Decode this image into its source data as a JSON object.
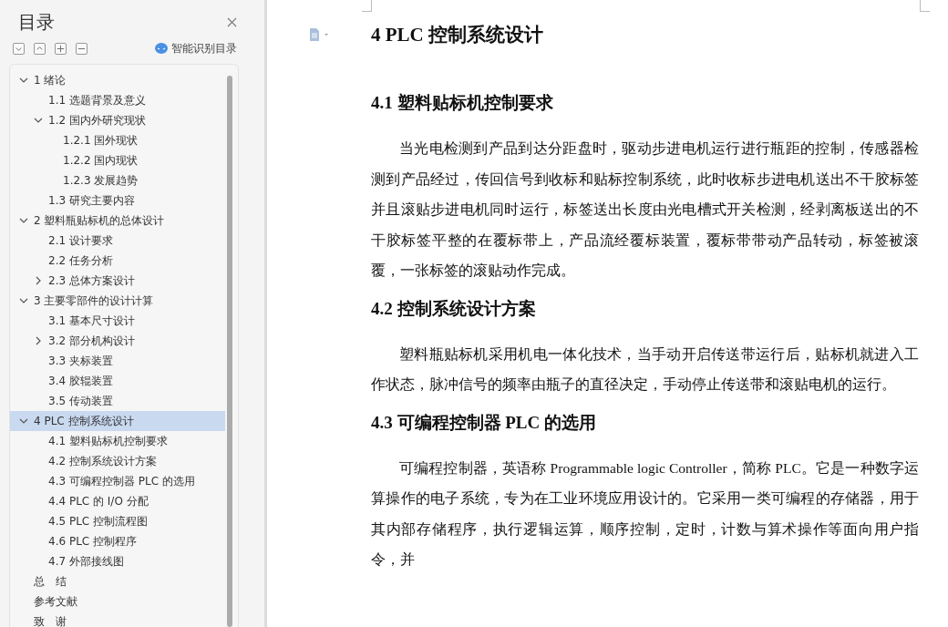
{
  "sidebar": {
    "title": "目录",
    "smart_toc_label": "智能识别目录",
    "toc": [
      {
        "label": "1 绪论",
        "selected": false,
        "expanded": true,
        "children": [
          {
            "label": "1.1 选题背景及意义",
            "selected": false
          },
          {
            "label": "1.2 国内外研究现状",
            "selected": false,
            "expanded": true,
            "children": [
              {
                "label": "1.2.1 国外现状",
                "selected": false
              },
              {
                "label": "1.2.2 国内现状",
                "selected": false
              },
              {
                "label": "1.2.3 发展趋势",
                "selected": false
              }
            ]
          },
          {
            "label": "1.3 研究主要内容",
            "selected": false
          }
        ]
      },
      {
        "label": "2 塑料瓶贴标机的总体设计",
        "selected": false,
        "expanded": true,
        "children": [
          {
            "label": "2.1 设计要求",
            "selected": false
          },
          {
            "label": "2.2 任务分析",
            "selected": false
          },
          {
            "label": "2.3 总体方案设计",
            "selected": false,
            "expanded": false
          }
        ]
      },
      {
        "label": "3 主要零部件的设计计算",
        "selected": false,
        "expanded": true,
        "children": [
          {
            "label": "3.1 基本尺寸设计",
            "selected": false
          },
          {
            "label": "3.2 部分机构设计",
            "selected": false,
            "expanded": false
          },
          {
            "label": "3.3 夹标装置",
            "selected": false
          },
          {
            "label": "3.4 胶辊装置",
            "selected": false
          },
          {
            "label": "3.5 传动装置",
            "selected": false
          }
        ]
      },
      {
        "label": "4 PLC 控制系统设计",
        "selected": true,
        "expanded": true,
        "children": [
          {
            "label": "4.1 塑料贴标机控制要求",
            "selected": false
          },
          {
            "label": "4.2 控制系统设计方案",
            "selected": false
          },
          {
            "label": "4.3 可编程控制器 PLC 的选用",
            "selected": false
          },
          {
            "label": "4.4 PLC 的 I/O 分配",
            "selected": false
          },
          {
            "label": "4.5 PLC 控制流程图",
            "selected": false
          },
          {
            "label": "4.6 PLC 控制程序",
            "selected": false
          },
          {
            "label": "4.7 外部接线图",
            "selected": false
          }
        ]
      },
      {
        "label": "总　结",
        "selected": false
      },
      {
        "label": "参考文献",
        "selected": false
      },
      {
        "label": "致　谢",
        "selected": false
      }
    ]
  },
  "document": {
    "blocks": [
      {
        "kind": "h1",
        "text": "4 PLC 控制系统设计"
      },
      {
        "kind": "h2",
        "text": "4.1 塑料贴标机控制要求"
      },
      {
        "kind": "p",
        "text": "当光电检测到产品到达分距盘时，驱动步进电机运行进行瓶距的控制，传感器检测到产品经过，传回信号到收标和贴标控制系统，此时收标步进电机送出不干胶标签并且滚贴步进电机同时运行，标签送出长度由光电槽式开关检测，经剥离板送出的不干胶标签平整的在覆标带上，产品流经覆标装置，覆标带带动产品转动，标签被滚覆，一张标签的滚贴动作完成。"
      },
      {
        "kind": "h2",
        "text": "4.2 控制系统设计方案"
      },
      {
        "kind": "p",
        "text": "塑料瓶贴标机采用机电一体化技术，当手动开启传送带运行后，贴标机就进入工作状态，脉冲信号的频率由瓶子的直径决定，手动停止传送带和滚贴电机的运行。"
      },
      {
        "kind": "h2",
        "text": "4.3 可编程控制器 PLC 的选用"
      },
      {
        "kind": "p",
        "text": "可编程控制器，英语称 Programmable logic Controller，简称 PLC。它是一种数字运算操作的电子系统，专为在工业环境应用设计的。它采用一类可编程的存储器，用于其内部存储程序，执行逻辑运算，顺序控制，定时，计数与算术操作等面向用户指令，并"
      }
    ]
  }
}
